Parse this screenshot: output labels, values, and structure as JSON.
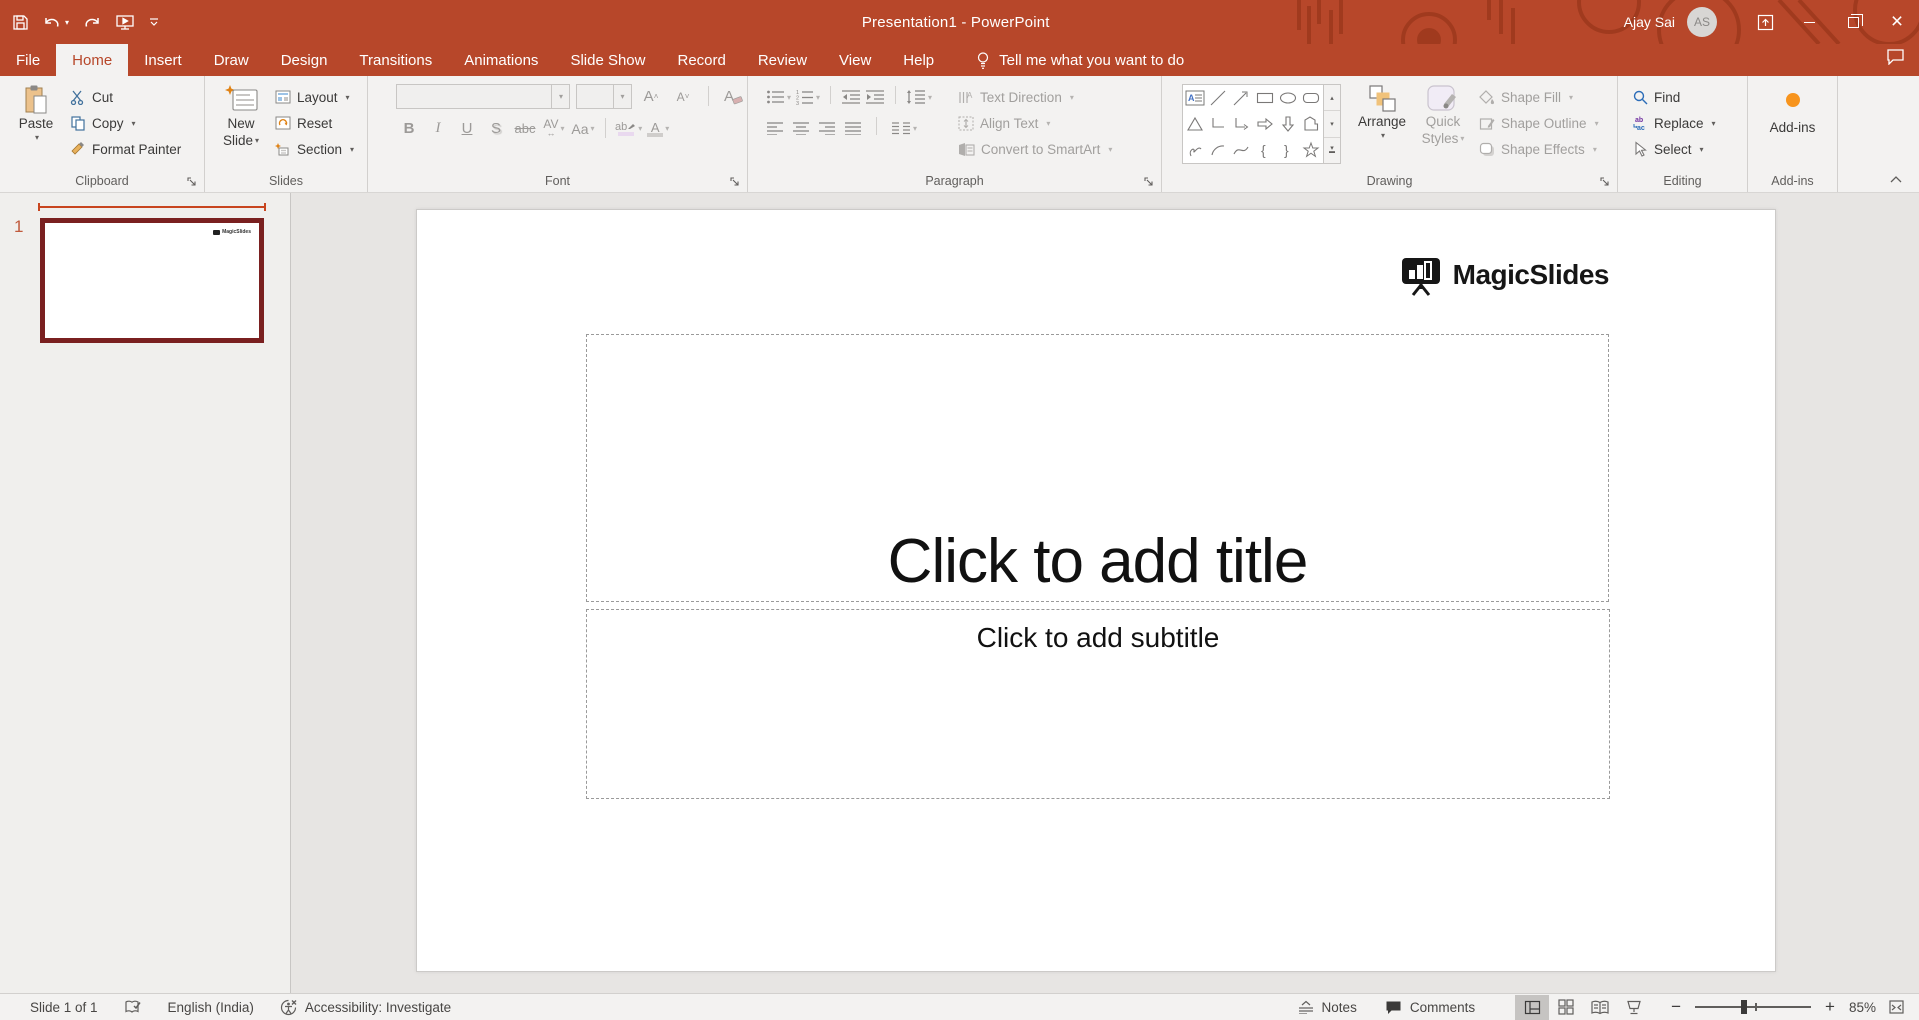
{
  "colors": {
    "accent": "#b7472a",
    "thumb_selection": "#7a2020",
    "addin_dot": "#f7941d"
  },
  "titlebar": {
    "title": "Presentation1 - PowerPoint",
    "user_name": "Ajay Sai",
    "avatar_initials": "AS"
  },
  "tabs": [
    "File",
    "Home",
    "Insert",
    "Draw",
    "Design",
    "Transitions",
    "Animations",
    "Slide Show",
    "Record",
    "Review",
    "View",
    "Help"
  ],
  "search": {
    "tell_me": "Tell me what you want to do"
  },
  "ribbon": {
    "clipboard": {
      "group_label": "Clipboard",
      "paste": "Paste",
      "cut": "Cut",
      "copy": "Copy",
      "format_painter": "Format Painter"
    },
    "slides": {
      "group_label": "Slides",
      "new_slide_line1": "New",
      "new_slide_line2": "Slide",
      "layout": "Layout",
      "reset": "Reset",
      "section": "Section"
    },
    "font": {
      "group_label": "Font",
      "bold": "B",
      "italic": "I",
      "underline": "U",
      "shadow": "S",
      "strikethrough": "abc",
      "spacing": "AV",
      "case": "Aa",
      "grow": "A",
      "shrink": "A",
      "clear": "A"
    },
    "paragraph": {
      "group_label": "Paragraph",
      "text_direction": "Text Direction",
      "align_text": "Align Text",
      "convert_smartart": "Convert to SmartArt"
    },
    "drawing": {
      "group_label": "Drawing",
      "arrange": "Arrange",
      "quick_styles_line1": "Quick",
      "quick_styles_line2": "Styles",
      "shape_fill": "Shape Fill",
      "shape_outline": "Shape Outline",
      "shape_effects": "Shape Effects"
    },
    "editing": {
      "group_label": "Editing",
      "find": "Find",
      "replace": "Replace",
      "select": "Select"
    },
    "addins": {
      "group_label": "Add-ins",
      "button_label": "Add-ins"
    }
  },
  "slide_panel": {
    "slide_number": "1"
  },
  "canvas": {
    "logo_text": "MagicSlides",
    "title_placeholder": "Click to add title",
    "subtitle_placeholder": "Click to add subtitle"
  },
  "statusbar": {
    "slide_counter": "Slide 1 of 1",
    "language": "English (India)",
    "accessibility": "Accessibility: Investigate",
    "notes": "Notes",
    "comments": "Comments",
    "zoom_level": "85%"
  }
}
